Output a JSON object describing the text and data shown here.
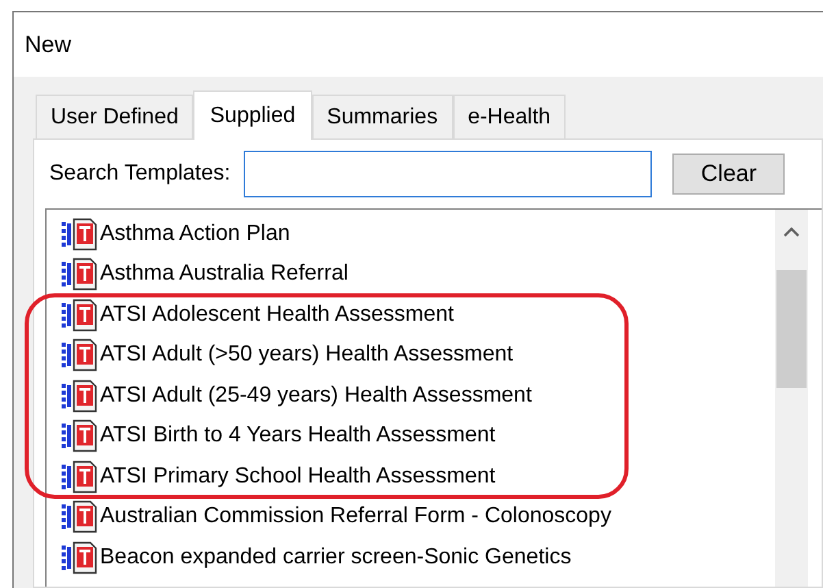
{
  "window": {
    "title": "New"
  },
  "tabs": [
    {
      "label": "User Defined",
      "selected": false
    },
    {
      "label": "Supplied",
      "selected": true
    },
    {
      "label": "Summaries",
      "selected": false
    },
    {
      "label": "e-Health",
      "selected": false
    }
  ],
  "search": {
    "label": "Search Templates:"
  },
  "clear_button": "Clear",
  "templates": [
    {
      "name": "Asthma Action Plan",
      "highlighted": false
    },
    {
      "name": "Asthma Australia Referral",
      "highlighted": false
    },
    {
      "name": "ATSI Adolescent Health Assessment",
      "highlighted": true
    },
    {
      "name": "ATSI Adult (>50 years) Health Assessment",
      "highlighted": true
    },
    {
      "name": "ATSI Adult (25-49 years) Health Assessment",
      "highlighted": true
    },
    {
      "name": "ATSI Birth to 4 Years Health Assessment",
      "highlighted": true
    },
    {
      "name": "ATSI Primary School Health Assessment",
      "highlighted": true
    },
    {
      "name": "Australian Commission Referral Form - Colonoscopy",
      "highlighted": false
    },
    {
      "name": "Beacon expanded carrier screen-Sonic Genetics",
      "highlighted": false
    }
  ]
}
